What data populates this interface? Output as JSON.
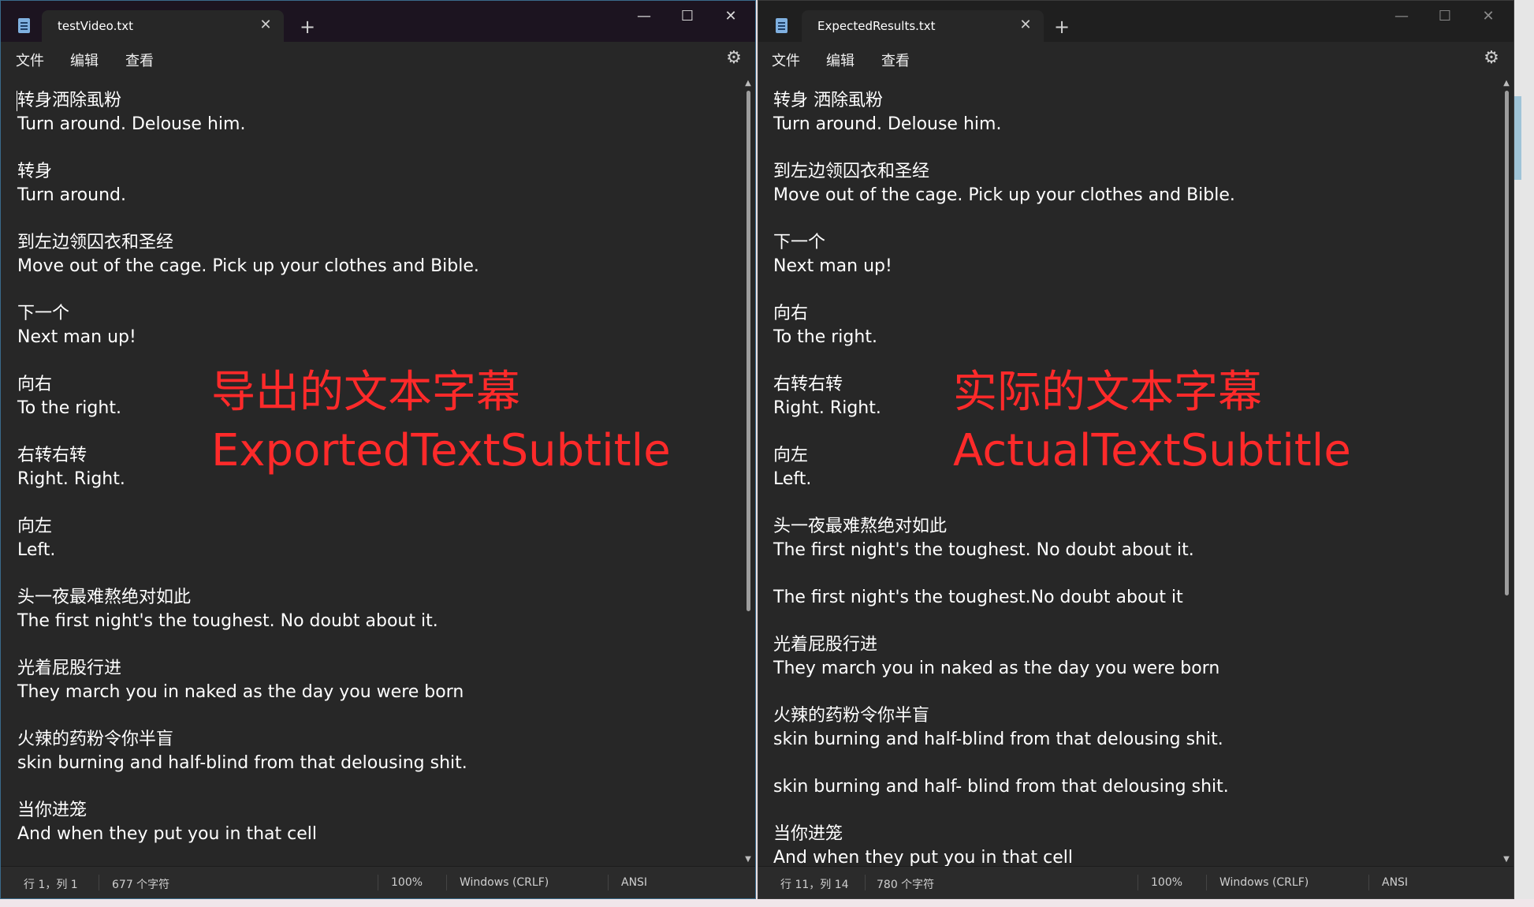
{
  "left": {
    "tab_title": "testVideo.txt",
    "menu": [
      "文件",
      "编辑",
      "查看"
    ],
    "lines": [
      "转身洒除虱粉",
      "Turn around. Delouse him.",
      "",
      "转身",
      "Turn around.",
      "",
      "到左边领囚衣和圣经",
      "Move out of the cage. Pick up your clothes and Bible.",
      "",
      "下一个",
      "Next man up!",
      "",
      "向右",
      "To the right.",
      "",
      "右转右转",
      "Right. Right.",
      "",
      "向左",
      "Left.",
      "",
      "头一夜最难熬绝对如此",
      "The first night's the toughest. No doubt about it.",
      "",
      "光着屁股行进",
      "They march you in naked as the day you were born",
      "",
      "火辣的药粉令你半盲",
      "skin burning and half-blind from that delousing shit.",
      "",
      "当你进笼",
      "And when they put you in that cell"
    ],
    "overlay_cn": "导出的文本字幕",
    "overlay_en": "ExportedTextSubtitle",
    "status": {
      "position": "行 1，列 1",
      "chars": "677 个字符",
      "zoom": "100%",
      "eol": "Windows (CRLF)",
      "encoding": "ANSI"
    },
    "scroll_fraction": 0.0
  },
  "right": {
    "tab_title": "ExpectedResults.txt",
    "menu": [
      "文件",
      "编辑",
      "查看"
    ],
    "lines": [
      "转身 洒除虱粉",
      "Turn around. Delouse him.",
      "",
      "到左边领囚衣和圣经",
      "Move out of the cage. Pick up your clothes and Bible.",
      "",
      "下一个",
      "Next man up!",
      "",
      "向右",
      "To the right.",
      "",
      "右转右转",
      "Right. Right.",
      "",
      "向左",
      "Left.",
      "",
      "头一夜最难熬绝对如此",
      "The first night's the toughest. No doubt about it.",
      "",
      "The first night's the toughest.No doubt about it",
      "",
      "光着屁股行进",
      "They march you in naked as the day you were born",
      "",
      "火辣的药粉令你半盲",
      "skin burning and half-blind from that delousing shit.",
      "",
      "skin burning and half- blind from that delousing shit.",
      "",
      "当你进笼",
      "And when they put you in that cell"
    ],
    "overlay_cn": "实际的文本字幕",
    "overlay_en": "ActualTextSubtitle",
    "status": {
      "position": "行 11，列 14",
      "chars": "780 个字符",
      "zoom": "100%",
      "eol": "Windows (CRLF)",
      "encoding": "ANSI"
    },
    "scroll_fraction": 0.0
  },
  "icons": {
    "app": "notepad-icon",
    "close": "close-icon",
    "new_tab": "plus-icon",
    "settings": "gear-icon"
  }
}
